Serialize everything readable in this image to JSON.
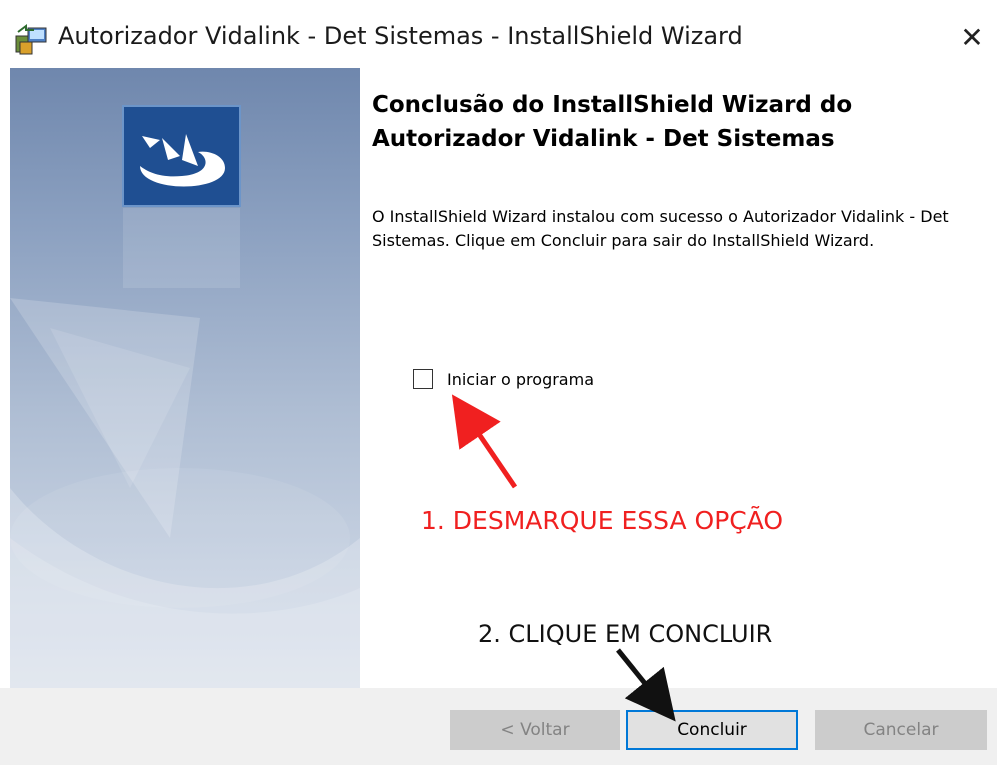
{
  "window": {
    "title": "Autorizador Vidalink - Det Sistemas - InstallShield Wizard",
    "close_glyph": "✕"
  },
  "content": {
    "heading": "Conclusão do InstallShield Wizard do Autorizador Vidalink - Det Sistemas",
    "body": "O InstallShield Wizard instalou com sucesso o Autorizador Vidalink - Det Sistemas. Clique em Concluir para sair do InstallShield Wizard.",
    "checkbox_label": "Iniciar o programa",
    "checkbox_checked": false
  },
  "annotations": {
    "step1": "1. DESMARQUE ESSA OPÇÃO",
    "step2": "2. CLIQUE EM CONCLUIR",
    "step1_color": "#f02020",
    "step2_color": "#111111"
  },
  "buttons": {
    "back": "< Voltar",
    "finish": "Concluir",
    "cancel": "Cancelar",
    "back_enabled": false,
    "cancel_enabled": false
  },
  "colors": {
    "accent": "#0078d7",
    "logo_blue": "#1f4f92"
  },
  "icons": {
    "app": "installer-icon",
    "close": "close-icon",
    "logo": "installshield-logo"
  }
}
